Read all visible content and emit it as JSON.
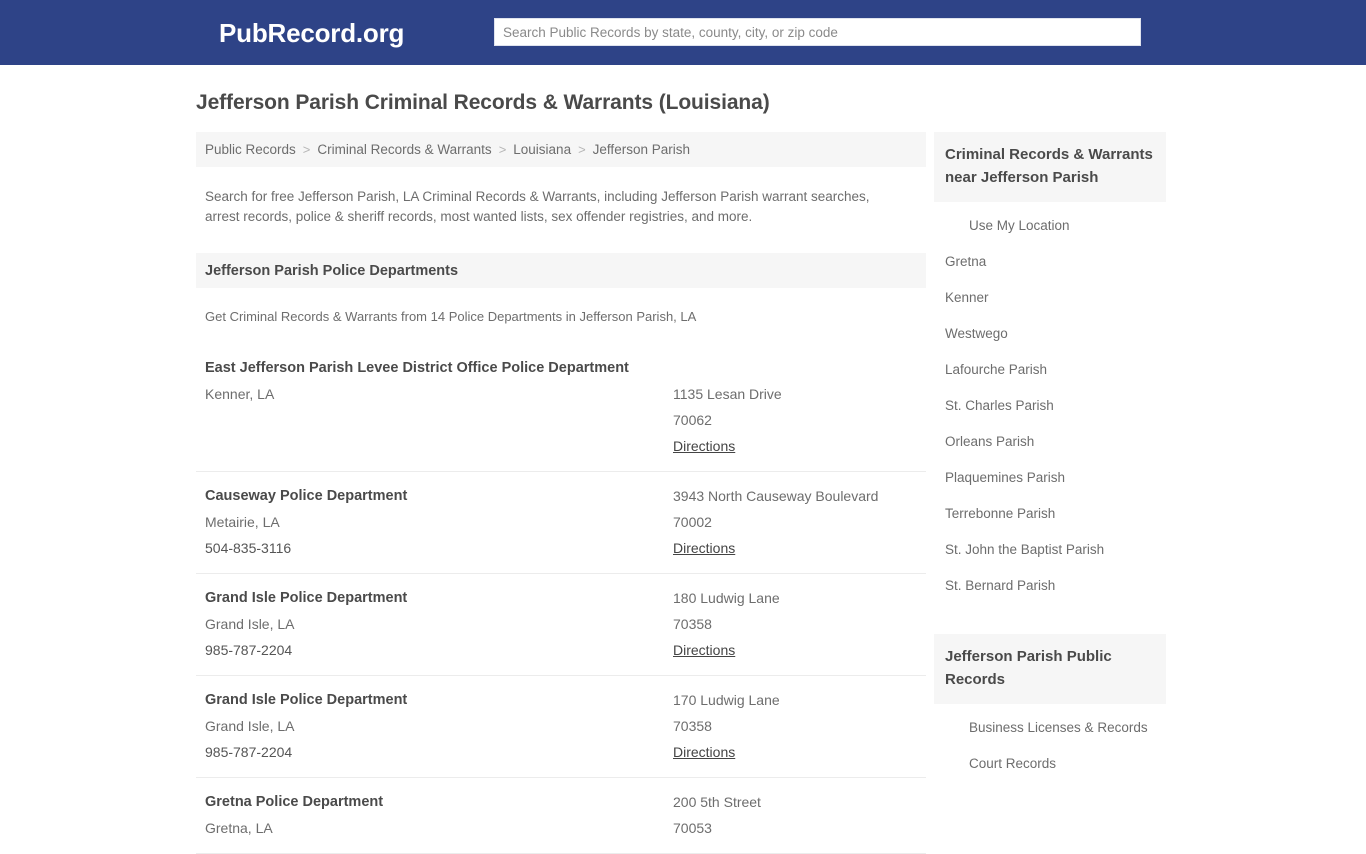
{
  "header": {
    "logo": "PubRecord.org",
    "search": {
      "placeholder": "Search Public Records by state, county, city, or zip code",
      "value": ""
    },
    "bar_color": "#2e4387"
  },
  "page": {
    "title": "Jefferson Parish Criminal Records & Warrants (Louisiana)",
    "breadcrumb": [
      "Public Records",
      "Criminal Records & Warrants",
      "Louisiana",
      "Jefferson Parish"
    ],
    "breadcrumb_separator": ">",
    "intro": "Search for free Jefferson Parish, LA Criminal Records & Warrants, including Jefferson Parish warrant searches, arrest records, police & sheriff records, most wanted lists, sex offender registries, and more."
  },
  "section": {
    "title": "Jefferson Parish Police Departments",
    "subtitle": "Get Criminal Records & Warrants from 14 Police Departments in Jefferson Parish, LA"
  },
  "listings": [
    {
      "name": "East Jefferson Parish Levee District Office Police Department",
      "city": "Kenner, LA",
      "phone": "",
      "street": "1135 Lesan Drive",
      "zip": "70062",
      "directions": "Directions",
      "two_line_name": true
    },
    {
      "name": "Causeway Police Department",
      "city": "Metairie, LA",
      "phone": "504-835-3116",
      "street": "3943 North Causeway Boulevard",
      "zip": "70002",
      "directions": "Directions",
      "two_line_name": false
    },
    {
      "name": "Grand Isle Police Department",
      "city": "Grand Isle, LA",
      "phone": "985-787-2204",
      "street": "180 Ludwig Lane",
      "zip": "70358",
      "directions": "Directions",
      "two_line_name": false
    },
    {
      "name": "Grand Isle Police Department",
      "city": "Grand Isle, LA",
      "phone": "985-787-2204",
      "street": "170 Ludwig Lane",
      "zip": "70358",
      "directions": "Directions",
      "two_line_name": false
    },
    {
      "name": "Gretna Police Department",
      "city": "Gretna, LA",
      "phone": "",
      "street": "200 5th Street",
      "zip": "70053",
      "directions": "",
      "two_line_name": false
    }
  ],
  "sidebar": {
    "nearby": {
      "title": "Criminal Records & Warrants near Jefferson Parish",
      "items": [
        {
          "label": "Use My Location",
          "indent": true
        },
        {
          "label": "Gretna",
          "indent": false
        },
        {
          "label": "Kenner",
          "indent": false
        },
        {
          "label": "Westwego",
          "indent": false
        },
        {
          "label": "Lafourche Parish",
          "indent": false
        },
        {
          "label": "St. Charles Parish",
          "indent": false
        },
        {
          "label": "Orleans Parish",
          "indent": false
        },
        {
          "label": "Plaquemines Parish",
          "indent": false
        },
        {
          "label": "Terrebonne Parish",
          "indent": false
        },
        {
          "label": "St. John the Baptist Parish",
          "indent": false
        },
        {
          "label": "St. Bernard Parish",
          "indent": false
        }
      ]
    },
    "public_records": {
      "title": "Jefferson Parish Public Records",
      "items": [
        {
          "label": "Business Licenses & Records",
          "indent": true
        },
        {
          "label": "Court Records",
          "indent": true
        }
      ]
    }
  }
}
